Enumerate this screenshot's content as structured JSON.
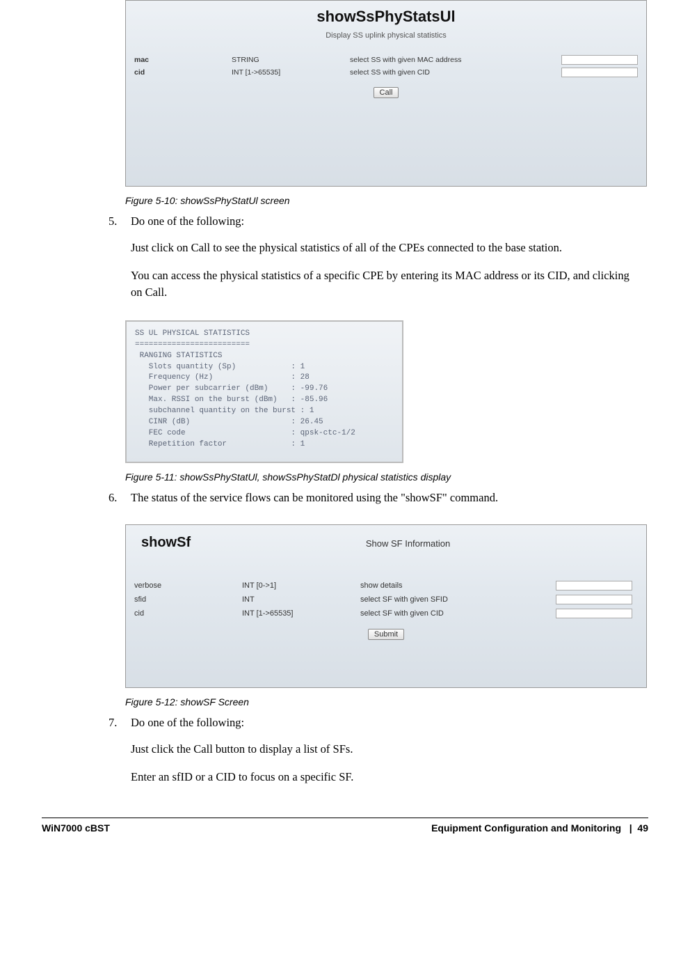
{
  "panel1": {
    "title": "showSsPhyStatsUl",
    "subtitle": "Display SS uplink physical statistics",
    "rows": [
      {
        "name": "mac",
        "type": "STRING",
        "desc": "select SS with given MAC address"
      },
      {
        "name": "cid",
        "type": "INT [1->65535]",
        "desc": "select SS with given CID"
      }
    ],
    "button": "Call"
  },
  "caption1": "Figure 5-10: showSsPhyStatUl screen",
  "step5": {
    "num": "5.",
    "text": "Do one of the following:"
  },
  "para1": "Just click on Call to see the physical statistics of all of the CPEs connected to the base station.",
  "para2": "You can access the physical statistics of a specific CPE by entering its MAC address or its CID, and clicking on Call.",
  "terminal": "SS UL PHYSICAL STATISTICS\n=========================\n RANGING STATISTICS\n   Slots quantity (Sp)            : 1\n   Frequency (Hz)                 : 28\n   Power per subcarrier (dBm)     : -99.76\n   Max. RSSI on the burst (dBm)   : -85.96\n   subchannel quantity on the burst : 1\n   CINR (dB)                      : 26.45\n   FEC code                       : qpsk-ctc-1/2\n   Repetition factor              : 1",
  "caption2": "Figure 5-11: showSsPhyStatUl, showSsPhyStatDl physical statistics display",
  "step6": {
    "num": "6.",
    "text": "The status of the service flows can be monitored using the \"showSF\" command."
  },
  "panel3": {
    "title": "showSf",
    "subtitle": "Show SF Information",
    "rows": [
      {
        "name": "verbose",
        "type": "INT [0->1]",
        "desc": "show details"
      },
      {
        "name": "sfid",
        "type": "INT",
        "desc": "select SF with given SFID"
      },
      {
        "name": "cid",
        "type": "INT [1->65535]",
        "desc": "select SF with given CID"
      }
    ],
    "button": "Submit"
  },
  "caption3": "Figure 5-12: showSF Screen",
  "step7": {
    "num": "7.",
    "text": "Do one of the following:"
  },
  "para3": "Just click the Call button to display a list of SFs.",
  "para4": "Enter an sfID or a CID to focus on a specific SF.",
  "footer": {
    "left": "WiN7000 cBST",
    "section": "Equipment Configuration and Monitoring",
    "sep": "|",
    "page": "49"
  }
}
